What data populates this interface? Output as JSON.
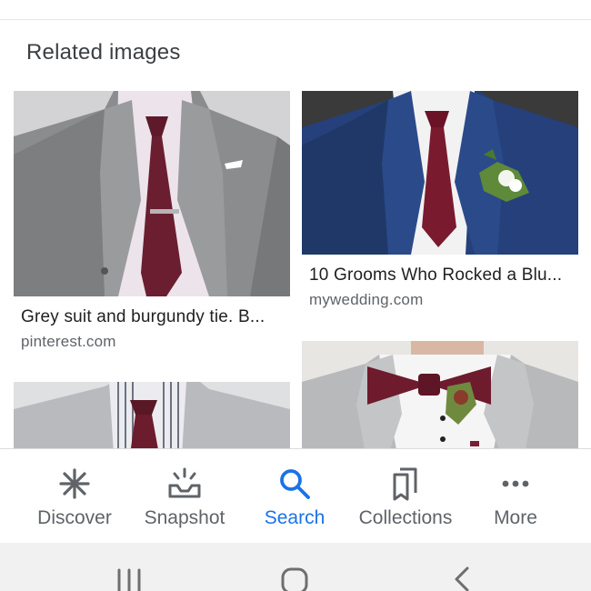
{
  "section": {
    "title": "Related images"
  },
  "results": [
    {
      "title": "Grey suit and burgundy tie. B...",
      "source": "pinterest.com"
    },
    {
      "title": "10 Grooms Who Rocked a Blu...",
      "source": "mywedding.com"
    },
    {
      "title": "",
      "source": ""
    },
    {
      "title": "",
      "source": ""
    }
  ],
  "bottom_nav": {
    "items": [
      {
        "label": "Discover",
        "icon": "discover-icon"
      },
      {
        "label": "Snapshot",
        "icon": "snapshot-icon"
      },
      {
        "label": "Search",
        "icon": "search-icon",
        "active": true
      },
      {
        "label": "Collections",
        "icon": "collections-icon"
      },
      {
        "label": "More",
        "icon": "more-icon"
      }
    ]
  },
  "system_nav": {
    "buttons": [
      "recent-apps-icon",
      "home-icon",
      "back-icon"
    ]
  },
  "colors": {
    "accent": "#1a73e8",
    "text_primary": "#202124",
    "text_secondary": "#5f6368"
  }
}
